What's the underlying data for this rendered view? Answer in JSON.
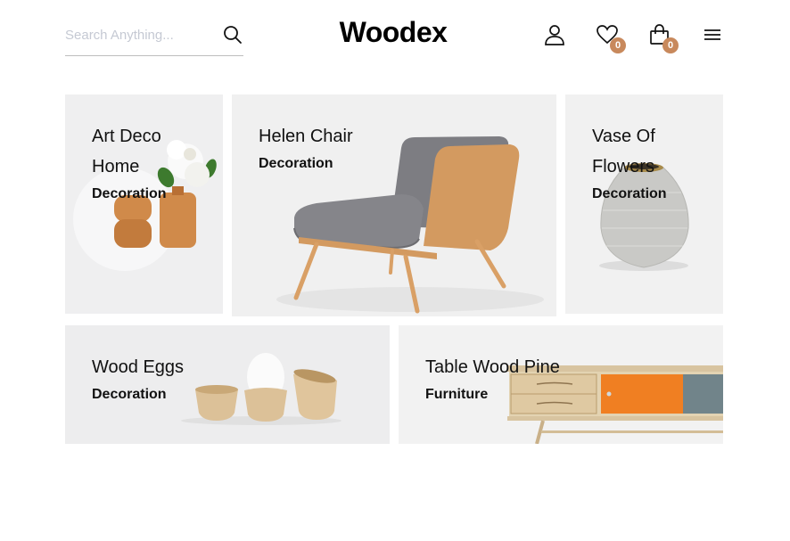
{
  "header": {
    "search": {
      "placeholder": "Search Anything...",
      "value": ""
    },
    "logo": "Woodex",
    "icons": {
      "account": "user-icon",
      "wishlist": "heart-icon",
      "cart": "shopping-bag-icon",
      "menu": "hamburger-menu-icon",
      "search": "search-icon"
    },
    "wishlist_count": "0",
    "cart_count": "0",
    "badge_color": "#c8895c"
  },
  "cards": [
    {
      "title_line1": "Art Deco",
      "title_line2": "Home",
      "category": "Decoration",
      "image": "wooden-vases-with-flower"
    },
    {
      "title_line1": "Helen Chair",
      "category": "Decoration",
      "image": "lounge-chair"
    },
    {
      "title_line1": "Vase Of",
      "title_line2": "Flowers",
      "category": "Decoration",
      "image": "stone-vase"
    },
    {
      "title_line1": "Wood Eggs",
      "category": "Decoration",
      "image": "wooden-egg-cups"
    },
    {
      "title_line1": "Table Wood Pine",
      "category": "Furniture",
      "image": "wood-sideboard"
    }
  ]
}
